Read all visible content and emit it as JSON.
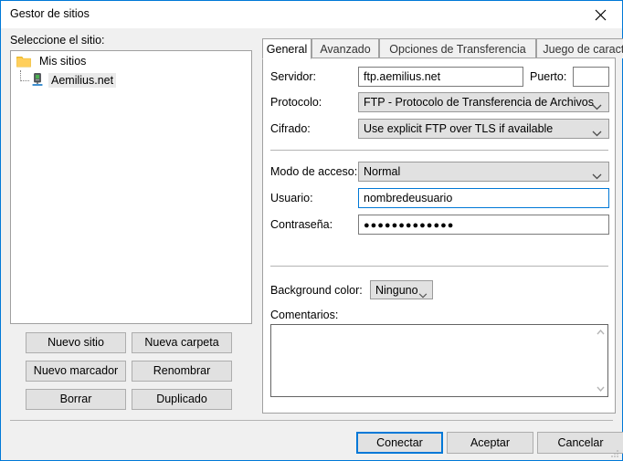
{
  "window": {
    "title": "Gestor de sitios",
    "close_icon": "close-icon",
    "accent_color": "#0078d7"
  },
  "left_panel": {
    "label": "Seleccione el sitio:",
    "tree": [
      {
        "label": "Mis sitios",
        "icon": "folder-icon",
        "level": 0,
        "selected": false
      },
      {
        "label": "Aemilius.net",
        "icon": "server-icon",
        "level": 1,
        "selected": true
      }
    ],
    "buttons": [
      {
        "label": "Nuevo sitio"
      },
      {
        "label": "Nueva carpeta"
      },
      {
        "label": "Nuevo marcador"
      },
      {
        "label": "Renombrar"
      },
      {
        "label": "Borrar"
      },
      {
        "label": "Duplicado"
      }
    ]
  },
  "tabs": [
    {
      "label": "General",
      "active": true
    },
    {
      "label": "Avanzado",
      "active": false
    },
    {
      "label": "Opciones de Transferencia",
      "active": false
    },
    {
      "label": "Juego de caracteres",
      "active": false
    }
  ],
  "general": {
    "servidor_label": "Servidor:",
    "servidor_value": "ftp.aemilius.net",
    "puerto_label": "Puerto:",
    "puerto_value": "",
    "puerto_placeholder": "",
    "protocolo_label": "Protocolo:",
    "protocolo_value": "FTP - Protocolo de Transferencia de Archivos",
    "cifrado_label": "Cifrado:",
    "cifrado_value": "Use explicit FTP over TLS if available",
    "modo_acceso_label": "Modo de acceso:",
    "modo_acceso_value": "Normal",
    "usuario_label": "Usuario:",
    "usuario_value": "nombredeusuario",
    "contrasena_label": "Contraseña:",
    "contrasena_value": "●●●●●●●●●●●●●",
    "background_color_label": "Background color:",
    "background_color_value": "Ninguno",
    "comentarios_label": "Comentarios:",
    "comentarios_value": ""
  },
  "footer": {
    "connect_label": "Conectar",
    "ok_label": "Aceptar",
    "cancel_label": "Cancelar"
  }
}
